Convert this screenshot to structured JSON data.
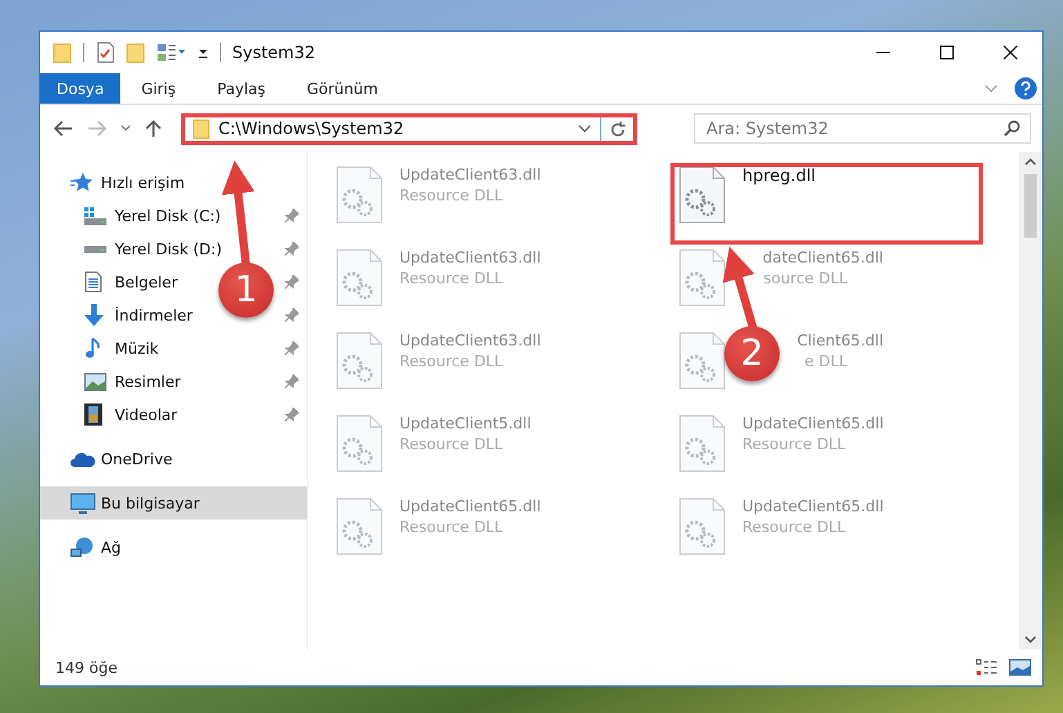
{
  "window": {
    "title": "System32"
  },
  "ribbon": {
    "tabs": [
      {
        "label": "Dosya",
        "selected": true
      },
      {
        "label": "Giriş",
        "selected": false
      },
      {
        "label": "Paylaş",
        "selected": false
      },
      {
        "label": "Görünüm",
        "selected": false
      }
    ]
  },
  "address_bar": {
    "path": "C:\\Windows\\System32"
  },
  "search": {
    "placeholder": "Ara: System32"
  },
  "sidebar": {
    "items": [
      {
        "label": "Hızlı erişim",
        "kind": "star",
        "selected": false,
        "children": [
          {
            "label": "Yerel Disk (C:)",
            "kind": "system-drive",
            "pinned": true,
            "selected": false
          },
          {
            "label": "Yerel Disk (D:)",
            "kind": "drive",
            "pinned": true,
            "selected": false
          },
          {
            "label": "Belgeler",
            "kind": "document",
            "pinned": true,
            "selected": false
          },
          {
            "label": "İndirmeler",
            "kind": "download",
            "pinned": true,
            "selected": false
          },
          {
            "label": "Müzik",
            "kind": "music",
            "pinned": true,
            "selected": false
          },
          {
            "label": "Resimler",
            "kind": "pictures",
            "pinned": true,
            "selected": false
          },
          {
            "label": "Videolar",
            "kind": "video",
            "pinned": true,
            "selected": false
          }
        ]
      },
      {
        "label": "OneDrive",
        "kind": "cloud",
        "selected": false
      },
      {
        "label": "Bu bilgisayar",
        "kind": "computer",
        "selected": true
      },
      {
        "label": "Ağ",
        "kind": "network",
        "selected": false
      }
    ]
  },
  "files": [
    {
      "name": "UpdateClient63.dll",
      "type": "Resource DLL",
      "blurred": true
    },
    {
      "name": "hpreg.dll",
      "blurred": false
    },
    {
      "name": "UpdateClient63.dll",
      "type": "Resource DLL",
      "blurred": true
    },
    {
      "name": "dateClient65.dll",
      "type": "source DLL",
      "blurred": true,
      "covered": true
    },
    {
      "name": "UpdateClient63.dll",
      "type": "Resource DLL",
      "blurred": true
    },
    {
      "name": "Client65.dll",
      "type": "e DLL",
      "blurred": true,
      "covered": true
    },
    {
      "name": "UpdateClient5.dll",
      "type": "Resource DLL",
      "blurred": true
    },
    {
      "name": "UpdateClient65.dll",
      "type": "Resource DLL",
      "blurred": true
    },
    {
      "name": "UpdateClient65.dll",
      "type": "Resource DLL",
      "blurred": true
    },
    {
      "name": "UpdateClient65.dll",
      "type": "Resource DLL",
      "blurred": true
    }
  ],
  "status_bar": {
    "item_count": "149 öğe"
  },
  "annotations": [
    {
      "label": "1"
    },
    {
      "label": "2"
    }
  ]
}
